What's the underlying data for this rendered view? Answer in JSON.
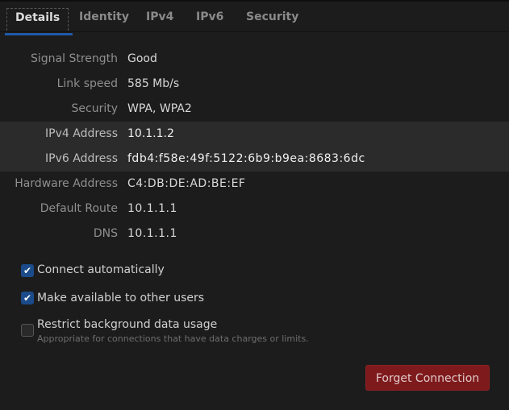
{
  "tabs": [
    {
      "label": "Details",
      "active": true
    },
    {
      "label": "Identity"
    },
    {
      "label": "IPv4"
    },
    {
      "label": "IPv6"
    },
    {
      "label": "Security"
    }
  ],
  "details": [
    {
      "label": "Signal Strength",
      "value": "Good"
    },
    {
      "label": "Link speed",
      "value": "585 Mb/s"
    },
    {
      "label": "Security",
      "value": "WPA, WPA2"
    },
    {
      "label": "IPv4 Address",
      "value": "10.1.1.2"
    },
    {
      "label": "IPv6 Address",
      "value": "fdb4:f58e:49f:5122:6b9:b9ea:8683:6dc"
    },
    {
      "label": "Hardware Address",
      "value": "C4:DB:DE:AD:BE:EF"
    },
    {
      "label": "Default Route",
      "value": "10.1.1.1"
    },
    {
      "label": "DNS",
      "value": "10.1.1.1"
    }
  ],
  "options": [
    {
      "label": "Connect automatically",
      "checked": true
    },
    {
      "label": "Make available to other users",
      "checked": true
    },
    {
      "label": "Restrict background data usage",
      "checked": false,
      "description": "Appropriate for connections that have data charges or limits."
    }
  ],
  "forget_button": "Forget Connection",
  "colors": {
    "accent": "#1f5aa8",
    "destructive": "#7e1a1c"
  }
}
